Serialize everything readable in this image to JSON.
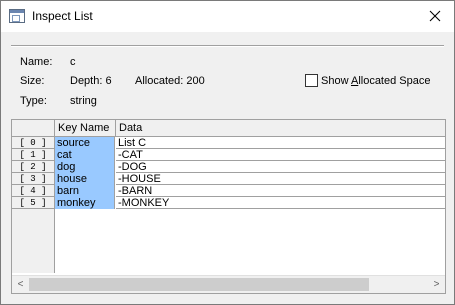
{
  "window": {
    "title": "Inspect List",
    "close_glyph": "close-icon"
  },
  "info": {
    "name_label": "Name:",
    "name_value": "c",
    "size_label": "Size:",
    "depth_text": "Depth: 6",
    "allocated_text": "Allocated: 200",
    "type_label": "Type:",
    "type_value": "string",
    "show_allocated": {
      "label_pre": "Show ",
      "label_accel": "A",
      "label_post": "llocated Space",
      "checked": false
    }
  },
  "grid": {
    "columns": [
      "Key Name",
      "Data"
    ],
    "rows": [
      {
        "index": "[ 0 ]",
        "key": "source",
        "data": "List C"
      },
      {
        "index": "[ 1 ]",
        "key": "cat",
        "data": "-CAT"
      },
      {
        "index": "[ 2 ]",
        "key": "dog",
        "data": "-DOG"
      },
      {
        "index": "[ 3 ]",
        "key": "house",
        "data": "-HOUSE"
      },
      {
        "index": "[ 4 ]",
        "key": "barn",
        "data": "-BARN"
      },
      {
        "index": "[ 5 ]",
        "key": "monkey",
        "data": "-MONKEY"
      }
    ],
    "scroll_left_glyph": "<",
    "scroll_right_glyph": ">"
  },
  "colors": {
    "key_highlight": "#99c9ff",
    "window_bg": "#f0f0f0",
    "grid_line": "#a0a0a0"
  }
}
